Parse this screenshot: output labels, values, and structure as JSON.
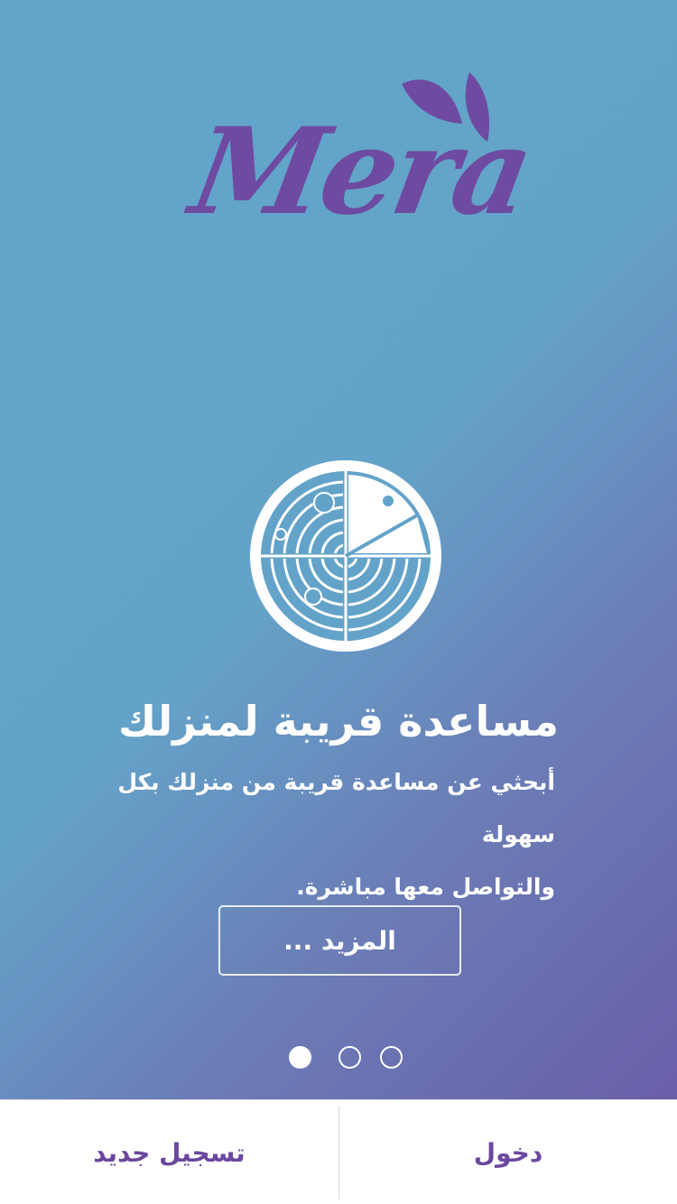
{
  "brand": {
    "name": "Mera",
    "logo_color": "#6e4aa2"
  },
  "feature": {
    "icon": "radar-icon",
    "title": "مساعدة قريبة لمنزلك",
    "description_line1": "أبحثي عن مساعدة قريبة من منزلك بكل سهولة",
    "description_line2": "والتواصل معها مباشرة."
  },
  "more_button": {
    "label": "المزيد ..."
  },
  "pagination": {
    "pages": 3,
    "active_index": 0
  },
  "bottom_bar": {
    "register_label": "تسجيل جديد",
    "login_label": "دخول",
    "text_color": "#6b479e"
  },
  "colors": {
    "gradient_start": "#62a5ca",
    "gradient_end": "#6a5fa9"
  }
}
